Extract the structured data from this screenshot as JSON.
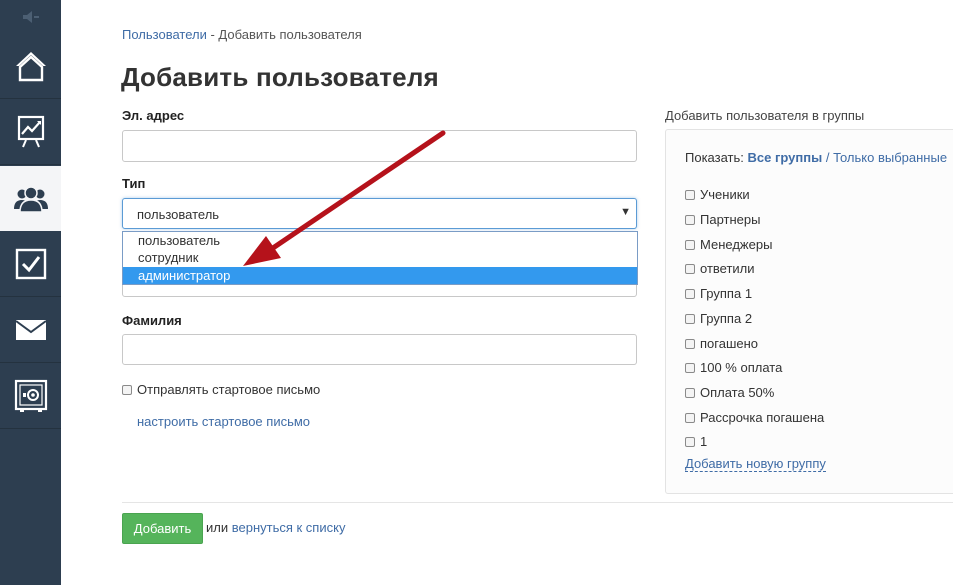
{
  "breadcrumb": {
    "parent": "Пользователи",
    "separator": " - ",
    "current": "Добавить пользователя"
  },
  "page_title": "Добавить пользователя",
  "form": {
    "email_label": "Эл. адрес",
    "email_value": "",
    "type_label": "Тип",
    "type_selected": "пользователь",
    "type_options": [
      "пользователь",
      "сотрудник",
      "администратор"
    ],
    "type_highlighted_option": "администратор",
    "lastname_label": "Фамилия",
    "lastname_value": "",
    "send_welcome_label": "Отправлять стартовое письмо",
    "setup_welcome_link": "настроить стартовое письмо"
  },
  "actions": {
    "add_button": "Добавить",
    "or_text": "или",
    "back_link": "вернуться к списку"
  },
  "groups": {
    "title": "Добавить пользователя в группы",
    "show_label": "Показать:",
    "show_all": "Все группы",
    "show_separator": "/",
    "show_selected": "Только выбранные",
    "items": [
      "Ученики",
      "Партнеры",
      "Менеджеры",
      "ответили",
      "Группа 1",
      "Группа 2",
      "погашено",
      "100 % оплата",
      "Оплата 50%",
      "Рассрочка погашена",
      "1"
    ],
    "add_group_link": "Добавить новую группу"
  },
  "sidebar": {
    "items": [
      "home-icon",
      "chart-icon",
      "users-icon",
      "tasks-icon",
      "mail-icon",
      "settings-icon"
    ],
    "active_item": "users-icon"
  },
  "colors": {
    "sidebar_bg": "#2d3e50",
    "link": "#3f6ca6",
    "primary_button": "#55b45b",
    "selected_option": "#3399ee",
    "annotation_arrow": "#b5121b"
  }
}
